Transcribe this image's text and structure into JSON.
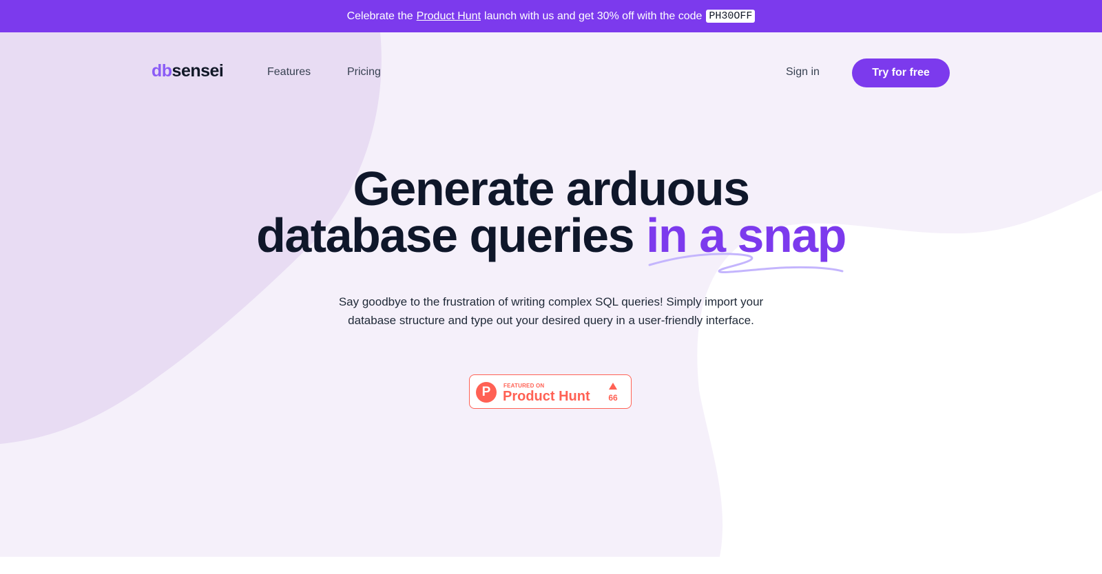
{
  "banner": {
    "prefix": "Celebrate the",
    "link": "Product Hunt",
    "middle": "launch with us and get 30% off with the code",
    "code": "PH30OFF"
  },
  "nav": {
    "logo_db": "db",
    "logo_sensei": "sensei",
    "features": "Features",
    "pricing": "Pricing",
    "sign_in": "Sign in",
    "try_free": "Try for free"
  },
  "hero": {
    "headline_line1": "Generate arduous",
    "headline_line2_plain": "database queries",
    "headline_line2_accent": "in a snap",
    "subtext": "Say goodbye to the frustration of writing complex SQL queries! Simply import your database structure and type out your desired query in a user-friendly interface."
  },
  "product_hunt_badge": {
    "logo_letter": "P",
    "small_label": "FEATURED ON",
    "big_label": "Product Hunt",
    "upvotes": "66"
  },
  "colors": {
    "brand": "#7c3aed",
    "brand_light": "#8b5cf6",
    "bg_light": "#f5f0fa",
    "bg_blob": "#e8dcf3",
    "product_hunt": "#ff6154"
  }
}
